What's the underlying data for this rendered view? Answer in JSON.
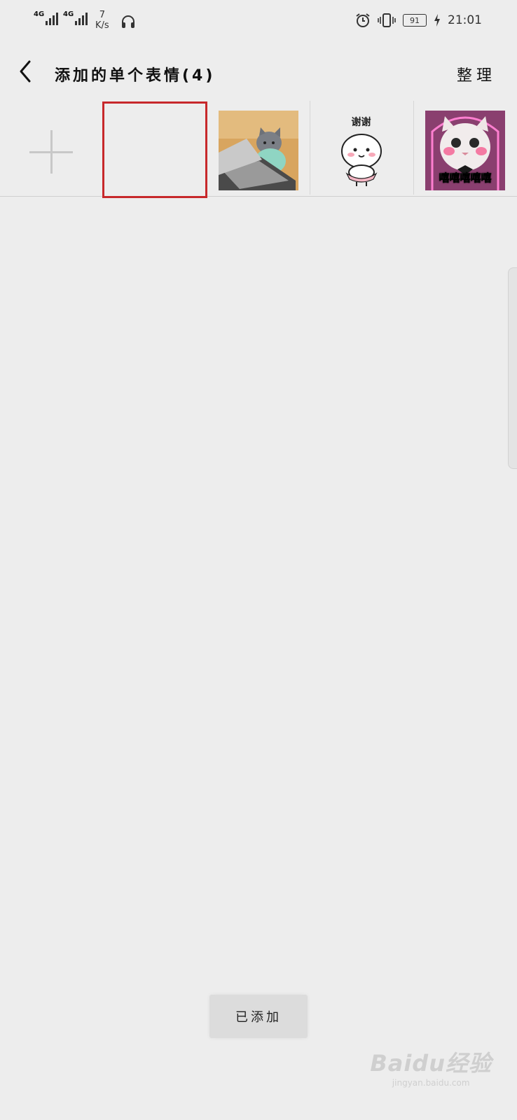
{
  "status_bar": {
    "network_1": "4G",
    "network_2": "4G",
    "speed_value": "7",
    "speed_unit": "K/s",
    "battery": "91",
    "time": "21:01",
    "icons": [
      "signal-icon",
      "signal-icon",
      "headset-icon",
      "alarm-icon",
      "vibrate-icon",
      "battery-icon",
      "charging-icon"
    ]
  },
  "header": {
    "title": "添加的单个表情(4)",
    "organize_label": "整理",
    "back_icon": "chevron-left-icon"
  },
  "stickers": {
    "count": 4,
    "items": [
      {
        "name": "add-sticker",
        "icon": "plus-icon",
        "caption": ""
      },
      {
        "name": "blank-sticker",
        "caption": ""
      },
      {
        "name": "cat-laptop-sticker",
        "caption": ""
      },
      {
        "name": "thanks-sticker",
        "caption": "谢谢"
      },
      {
        "name": "kitten-sticker",
        "caption": "嘻嘻嘻嘻嘻"
      }
    ]
  },
  "footer": {
    "added_label": "已添加"
  },
  "watermark": {
    "logo": "Baidu经验",
    "url": "jingyan.baidu.com"
  },
  "colors": {
    "background": "#ededed",
    "highlight_border": "#c7282b",
    "button_bg": "#dcdcdc"
  }
}
